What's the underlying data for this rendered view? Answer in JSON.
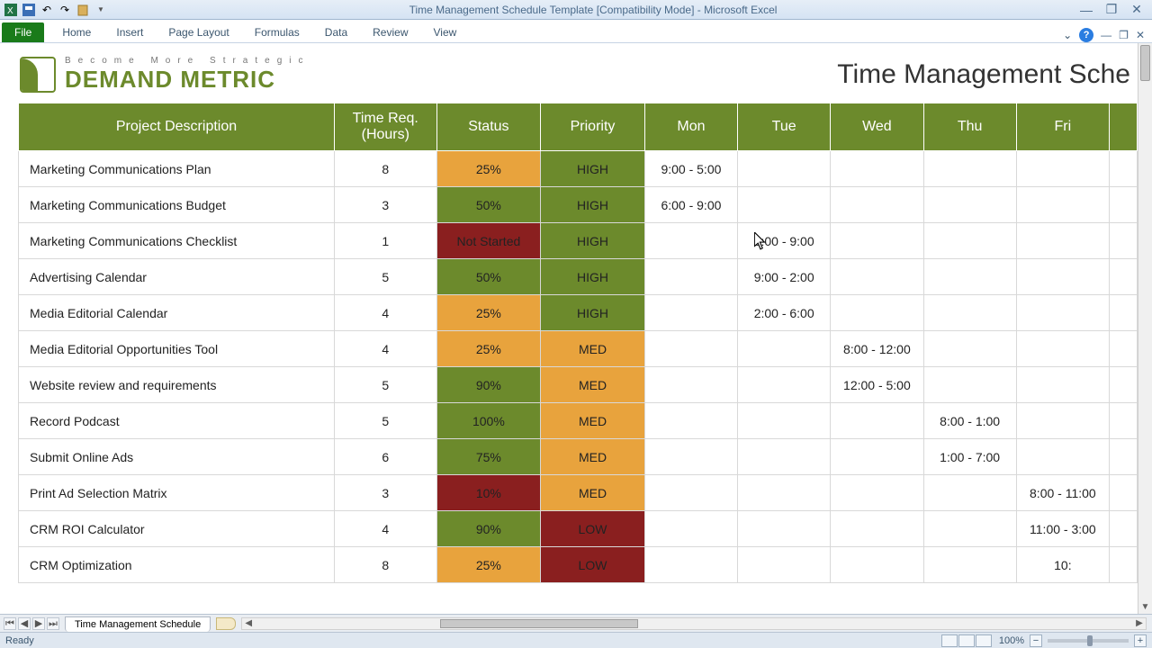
{
  "app": {
    "title": "Time Management Schedule Template  [Compatibility Mode]  -  Microsoft Excel"
  },
  "ribbon": {
    "file": "File",
    "tabs": [
      "Home",
      "Insert",
      "Page Layout",
      "Formulas",
      "Data",
      "Review",
      "View"
    ]
  },
  "brand": {
    "tagline": "Become More Strategic",
    "name": "DEMAND METRIC"
  },
  "page_title": "Time Management Sche",
  "headers": {
    "desc": "Project Description",
    "hours": "Time Req. (Hours)",
    "status": "Status",
    "priority": "Priority",
    "days": [
      "Mon",
      "Tue",
      "Wed",
      "Thu",
      "Fri"
    ]
  },
  "rows": [
    {
      "desc": "Marketing Communications Plan",
      "hours": "8",
      "status": "25%",
      "status_bg": "orange",
      "priority": "HIGH",
      "priority_bg": "green",
      "days": [
        "9:00 - 5:00",
        "",
        "",
        "",
        ""
      ]
    },
    {
      "desc": "Marketing Communications Budget",
      "hours": "3",
      "status": "50%",
      "status_bg": "green",
      "priority": "HIGH",
      "priority_bg": "green",
      "days": [
        "6:00 - 9:00",
        "",
        "",
        "",
        ""
      ]
    },
    {
      "desc": "Marketing Communications Checklist",
      "hours": "1",
      "status": "Not Started",
      "status_bg": "red",
      "priority": "HIGH",
      "priority_bg": "green",
      "days": [
        "",
        "8:00 - 9:00",
        "",
        "",
        ""
      ]
    },
    {
      "desc": "Advertising Calendar",
      "hours": "5",
      "status": "50%",
      "status_bg": "green",
      "priority": "HIGH",
      "priority_bg": "green",
      "days": [
        "",
        "9:00 - 2:00",
        "",
        "",
        ""
      ]
    },
    {
      "desc": "Media Editorial Calendar",
      "hours": "4",
      "status": "25%",
      "status_bg": "orange",
      "priority": "HIGH",
      "priority_bg": "green",
      "days": [
        "",
        "2:00 - 6:00",
        "",
        "",
        ""
      ]
    },
    {
      "desc": "Media Editorial Opportunities Tool",
      "hours": "4",
      "status": "25%",
      "status_bg": "orange",
      "priority": "MED",
      "priority_bg": "orange",
      "days": [
        "",
        "",
        "8:00 - 12:00",
        "",
        ""
      ]
    },
    {
      "desc": "Website review and requirements",
      "hours": "5",
      "status": "90%",
      "status_bg": "green",
      "priority": "MED",
      "priority_bg": "orange",
      "days": [
        "",
        "",
        "12:00 - 5:00",
        "",
        ""
      ]
    },
    {
      "desc": "Record Podcast",
      "hours": "5",
      "status": "100%",
      "status_bg": "green",
      "priority": "MED",
      "priority_bg": "orange",
      "days": [
        "",
        "",
        "",
        "8:00 - 1:00",
        ""
      ]
    },
    {
      "desc": "Submit Online Ads",
      "hours": "6",
      "status": "75%",
      "status_bg": "green",
      "priority": "MED",
      "priority_bg": "orange",
      "days": [
        "",
        "",
        "",
        "1:00 - 7:00",
        ""
      ]
    },
    {
      "desc": "Print Ad Selection Matrix",
      "hours": "3",
      "status": "10%",
      "status_bg": "red",
      "priority": "MED",
      "priority_bg": "orange",
      "days": [
        "",
        "",
        "",
        "",
        "8:00 - 11:00"
      ]
    },
    {
      "desc": "CRM ROI Calculator",
      "hours": "4",
      "status": "90%",
      "status_bg": "green",
      "priority": "LOW",
      "priority_bg": "red",
      "days": [
        "",
        "",
        "",
        "",
        "11:00 - 3:00"
      ]
    },
    {
      "desc": "CRM Optimization",
      "hours": "8",
      "status": "25%",
      "status_bg": "orange",
      "priority": "LOW",
      "priority_bg": "red",
      "days": [
        "",
        "",
        "",
        "",
        "10:"
      ]
    }
  ],
  "sheet_tab": "Time Management Schedule",
  "statusbar": {
    "ready": "Ready",
    "zoom": "100%"
  }
}
